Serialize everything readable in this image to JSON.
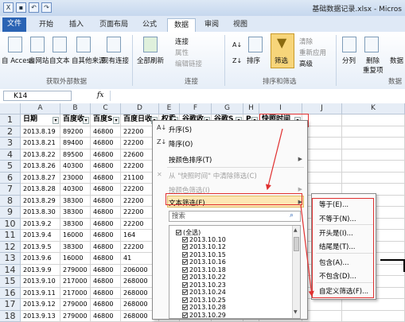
{
  "title_bar": {
    "title": "基础数据记录.xlsx - Micros"
  },
  "tabs": [
    "文件",
    "开始",
    "插入",
    "页面布局",
    "公式",
    "数据",
    "审阅",
    "视图"
  ],
  "ribbon": {
    "get_external": [
      "自 Access",
      "自网站",
      "自文本",
      "自其他来源"
    ],
    "existing": "现有连接",
    "refresh_all": "全部刷新",
    "connections": [
      "连接",
      "属性",
      "编辑链接"
    ],
    "sort_az": "A↓Z",
    "sort": "排序",
    "filter": "筛选",
    "clear": "清除",
    "reapply": "重新应用",
    "advanced": "高级",
    "split": "分列",
    "remove_dup": "删除",
    "remove_dup2": "重复项",
    "data_valid": "数据",
    "groups": [
      "获取外部数据",
      "连接",
      "排序和筛选",
      "数据"
    ]
  },
  "formula_bar": {
    "name_box": "K14",
    "fx": "fx"
  },
  "columns": [
    "A",
    "B",
    "C",
    "D",
    "E",
    "F",
    "G",
    "H",
    "I",
    "J",
    "K"
  ],
  "rows": [
    "1",
    "2",
    "3",
    "4",
    "5",
    "6",
    "7",
    "8",
    "9",
    "10",
    "11",
    "12",
    "13",
    "14",
    "15",
    "16",
    "17",
    "18"
  ],
  "headers": [
    "日期",
    "百度收",
    "百度S",
    "百度日收",
    "权重",
    "谷歌收",
    "谷歌S",
    "P",
    "快照时间"
  ],
  "table": [
    [
      "2013.8.19",
      "89200",
      "46800",
      "22200"
    ],
    [
      "2013.8.21",
      "89400",
      "46800",
      "22200"
    ],
    [
      "2013.8.22",
      "89500",
      "46800",
      "22600"
    ],
    [
      "2013.8.26",
      "40300",
      "46800",
      "22200"
    ],
    [
      "2013.8.27",
      "23000",
      "46800",
      "21100"
    ],
    [
      "2013.8.28",
      "40300",
      "46800",
      "22200"
    ],
    [
      "2013.8.29",
      "38300",
      "46800",
      "22200"
    ],
    [
      "2013.8.30",
      "38300",
      "46800",
      "22200"
    ],
    [
      "2013.9.2",
      "38300",
      "46800",
      "22200"
    ],
    [
      "2013.9.4",
      "16000",
      "46800",
      "164"
    ],
    [
      "2013.9.5",
      "38300",
      "46800",
      "22200"
    ],
    [
      "2013.9.6",
      "16000",
      "46800",
      "41"
    ],
    [
      "2013.9.9",
      "279000",
      "46800",
      "206000"
    ],
    [
      "2013.9.10",
      "217000",
      "46800",
      "268000"
    ],
    [
      "2013.9.11",
      "217000",
      "46800",
      "268000"
    ],
    [
      "2013.9.12",
      "279000",
      "46800",
      "268000"
    ],
    [
      "2013.9.13",
      "279000",
      "46800",
      "268000"
    ]
  ],
  "menu": {
    "sort_asc": "升序(S)",
    "sort_desc": "降序(O)",
    "sort_color": "按颜色排序(T)",
    "clear_filter": "从 \"快照时间\" 中清除筛选(C)",
    "filter_color": "按颜色筛选(I)",
    "text_filter": "文本筛选(F)",
    "search_placeholder": "搜索",
    "list": [
      "(全选)",
      "2013.10.10",
      "2013.10.12",
      "2013.10.15",
      "2013.10.16",
      "2013.10.18",
      "2013.10.22",
      "2013.10.23",
      "2013.10.24",
      "2013.10.25",
      "2013.10.28",
      "2013.10.29"
    ]
  },
  "submenu": [
    "等于(E)...",
    "不等于(N)...",
    "开头是(I)...",
    "结尾是(T)...",
    "包含(A)...",
    "不包含(D)...",
    "自定义筛选(F)..."
  ],
  "colors": {
    "accent": "#2a63b4",
    "highlight": "#e03030",
    "filter_icon": "#f7d57a"
  }
}
